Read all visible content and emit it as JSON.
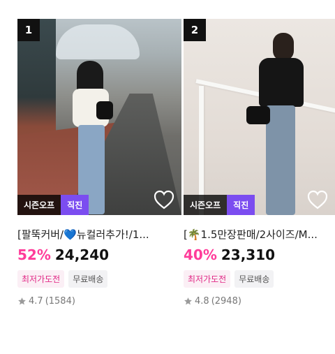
{
  "products": [
    {
      "rank": "1",
      "badges": {
        "season": "시즌오프",
        "photo": "직진"
      },
      "title": "[팔뚝커버/💙뉴컬러추가!/1...",
      "discount": "52%",
      "price": "24,240",
      "tags": [
        "최저가도전",
        "무료배송"
      ],
      "rating": "4.7",
      "reviews": "(1584)"
    },
    {
      "rank": "2",
      "badges": {
        "season": "시즌오프",
        "photo": "직진"
      },
      "title": "[🌴1.5만장판매/2사이즈/M...",
      "discount": "40%",
      "price": "23,310",
      "tags": [
        "최저가도전",
        "무료배송"
      ],
      "rating": "4.8",
      "reviews": "(2948)"
    }
  ],
  "colors": {
    "discount": "#ff3c9a",
    "badge_purple": "#7b4df0",
    "tag_pink_text": "#e12986"
  }
}
